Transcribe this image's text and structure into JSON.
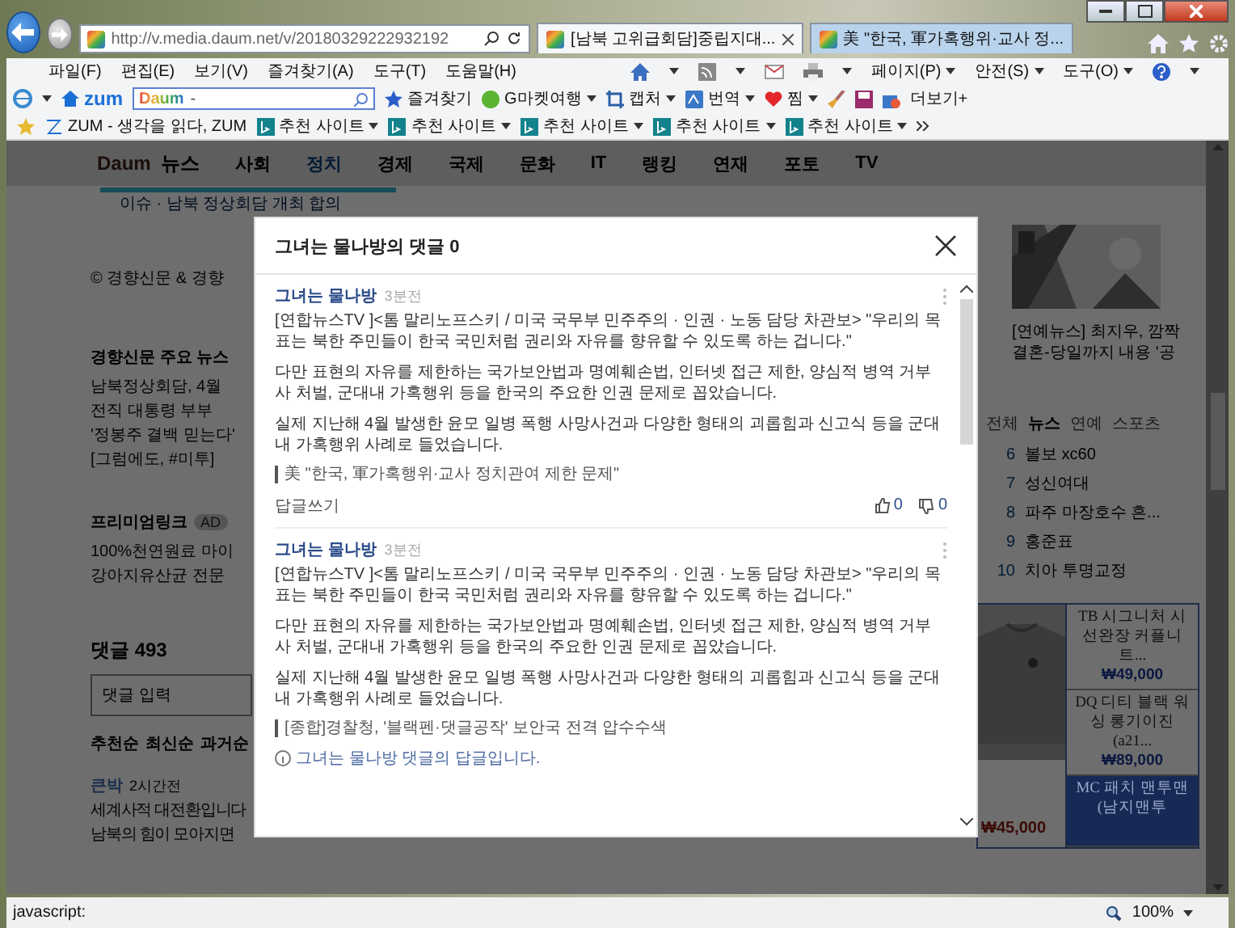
{
  "browser": {
    "address": "http://v.media.daum.net/v/20180329222932192",
    "tabs": [
      {
        "title": "[남북 고위급회담]중립지대...",
        "selected": true
      },
      {
        "title": "美 \"한국, 軍가혹행위·교사 정...",
        "selected": false
      }
    ],
    "menu": [
      "파일(F)",
      "편집(E)",
      "보기(V)",
      "즐겨찾기(A)",
      "도구(T)",
      "도움말(H)"
    ],
    "commands": [
      "페이지(P)",
      "안전(S)",
      "도구(O)"
    ],
    "toolbar": {
      "portal": "zum",
      "search_logo": "Daum",
      "search_value": "-",
      "items": [
        {
          "label": "즐겨찾기",
          "kind": "star",
          "dropdown": false
        },
        {
          "label": "G마켓여행",
          "kind": "gmarket",
          "dropdown": true
        },
        {
          "label": "캡처",
          "kind": "capture",
          "dropdown": true
        },
        {
          "label": "번역",
          "kind": "translate",
          "dropdown": true
        },
        {
          "label": "찜",
          "kind": "heart",
          "dropdown": true
        }
      ],
      "more": "더보기+"
    },
    "favorites": [
      {
        "label": "ZUM - 생각을 읽다, ZUM",
        "kind": "zum"
      },
      {
        "label": "추천 사이트",
        "kind": "bing"
      },
      {
        "label": "추천 사이트",
        "kind": "bing"
      },
      {
        "label": "추천 사이트",
        "kind": "bing"
      },
      {
        "label": "추천 사이트",
        "kind": "bing"
      },
      {
        "label": "추천 사이트",
        "kind": "bing"
      }
    ],
    "status": "javascript:",
    "zoom": "100%"
  },
  "page": {
    "logo": "Daum",
    "section": "뉴스",
    "nav": [
      {
        "label": "사회",
        "selected": false
      },
      {
        "label": "정치",
        "selected": true
      },
      {
        "label": "경제",
        "selected": false
      },
      {
        "label": "국제",
        "selected": false
      },
      {
        "label": "문화",
        "selected": false
      },
      {
        "label": "IT",
        "selected": false
      },
      {
        "label": "랭킹",
        "selected": false
      },
      {
        "label": "연재",
        "selected": false
      },
      {
        "label": "포토",
        "selected": false
      },
      {
        "label": "TV",
        "selected": false
      }
    ],
    "issue": "이슈 · 남북 정상회담 개최 합의",
    "copyright": "© 경향신문 & 경향",
    "press_news": {
      "title": "경향신문 주요 뉴스",
      "items": [
        "남북정상회담, 4월",
        "전직 대통령 부부",
        "'정봉주 결백 믿는다'",
        "[그럼에도, #미투]"
      ]
    },
    "premium": {
      "title": "프리미엄링크",
      "badge": "AD",
      "items": [
        "100%천연원료 마이",
        "강아지유산균 전문"
      ]
    },
    "comments": {
      "title": "댓글 493",
      "placeholder": "댓글 입력",
      "sorts": [
        "추천순",
        "최신순",
        "과거순"
      ],
      "first": {
        "user": "큰박",
        "time": "2시간전",
        "lines": [
          "세계사적 대전환입니다",
          "남북의 힘이 모아지면"
        ]
      }
    },
    "right": {
      "photo_caption": "[연예뉴스] 최지우, 깜짝 결혼-당일까지 내용 '공",
      "rank_tabs": [
        {
          "label": "전체",
          "selected": false
        },
        {
          "label": "뉴스",
          "selected": true
        },
        {
          "label": "연예",
          "selected": false
        },
        {
          "label": "스포츠",
          "selected": false
        }
      ],
      "ranks": [
        {
          "rank": "6",
          "title": "볼보 xc60"
        },
        {
          "rank": "7",
          "title": "성신여대"
        },
        {
          "rank": "8",
          "title": "파주 마장호수 흔..."
        },
        {
          "rank": "9",
          "title": "홍준표"
        },
        {
          "rank": "10",
          "title": "치아 투명교정"
        }
      ],
      "shop": {
        "price": "₩45,000",
        "items": [
          {
            "name": "TB 시그니처 시선완장 커플니트...",
            "price": "₩49,000",
            "selected": false
          },
          {
            "name": "DQ 디티 블랙 워싱 롱기이진 (a21...",
            "price": "₩89,000",
            "selected": false
          },
          {
            "name": "MC 패치 맨투맨 (남지맨투",
            "selected": true
          }
        ]
      }
    }
  },
  "modal": {
    "title": "그녀는 물나방의 댓글 0",
    "comments": [
      {
        "kind": "reply_bar",
        "user": "그녀는 물나방",
        "time": "3분전",
        "paragraphs": [
          "[연합뉴스TV ]<톰 말리노프스키 / 미국 국무부 민주주의 · 인권 · 노동 담당 차관보> \"우리의 목표는 북한 주민들이 한국 국민처럼 권리와 자유를 향유할 수 있도록 하는 겁니다.\"",
          "다만 표현의 자유를 제한하는 국가보안법과 명예훼손법, 인터넷 접근 제한, 양심적 병역 거부사 처벌, 군대내 가혹행위 등을 한국의 주요한 인권 문제로 꼽았습니다.",
          "실제 지난해 4월 발생한 윤모 일병 폭행 사망사건과 다양한 형태의 괴롭힘과 신고식 등을 군대내 가혹행위 사례로 들었습니다."
        ],
        "quote": "美 \"한국, 軍가혹행위·교사 정치관여 제한 문제\"",
        "reply_label": "답글쓰기",
        "likes": "0",
        "dislikes": "0"
      },
      {
        "kind": "reply_note",
        "user": "그녀는 물나방",
        "time": "3분전",
        "paragraphs": [
          "[연합뉴스TV ]<톰 말리노프스키 / 미국 국무부 민주주의 · 인권 · 노동 담당 차관보> \"우리의 목표는 북한 주민들이 한국 국민처럼 권리와 자유를 향유할 수 있도록 하는 겁니다.\"",
          "다만 표현의 자유를 제한하는 국가보안법과 명예훼손법, 인터넷 접근 제한, 양심적 병역 거부사 처벌, 군대내 가혹행위 등을 한국의 주요한 인권 문제로 꼽았습니다.",
          "실제 지난해 4월 발생한 윤모 일병 폭행 사망사건과 다양한 형태의 괴롭힘과 신고식 등을 군대내 가혹행위 사례로 들었습니다."
        ],
        "quote": "[종합]경찰청, '블랙펜·댓글공작' 보안국 전격 압수수색",
        "note": "그녀는 물나방 댓글의 답글입니다."
      }
    ]
  }
}
